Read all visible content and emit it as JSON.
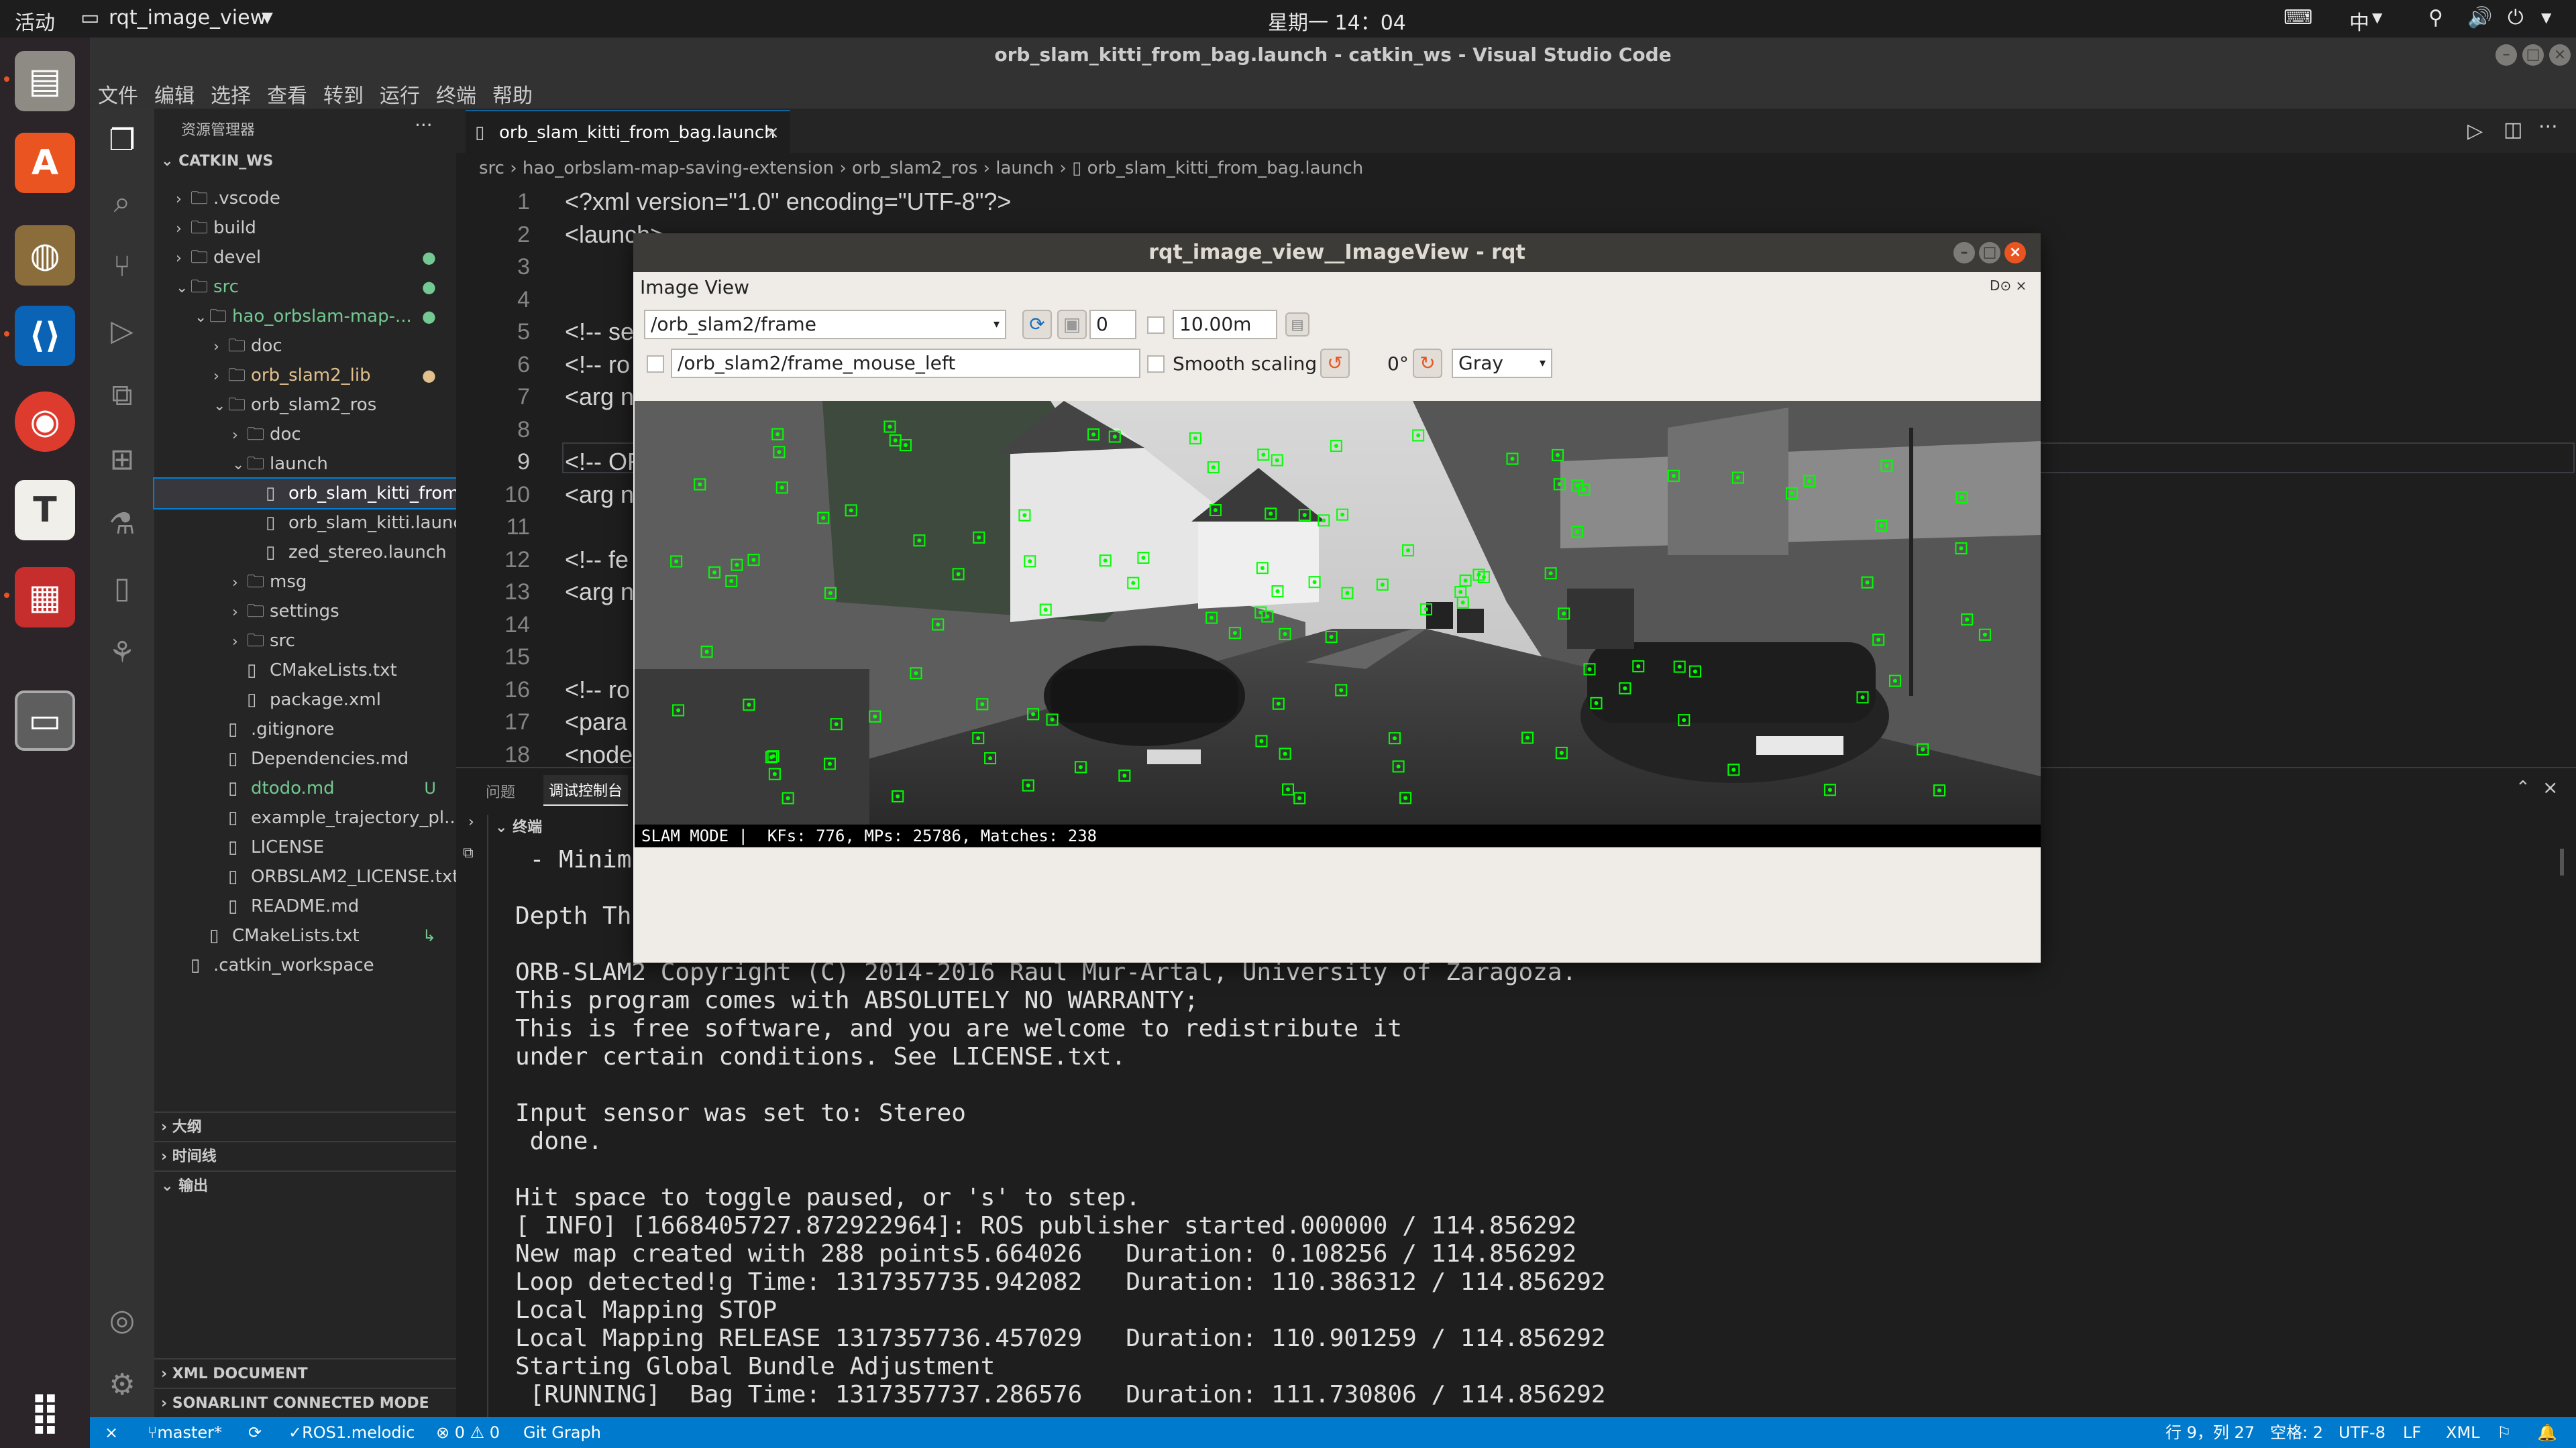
{
  "topbar": {
    "activities": "活动",
    "app_name": "rqt_image_view",
    "clock": "星期一 14：04",
    "ime": "中"
  },
  "window_title": "orb_slam_kitti_from_bag.launch - catkin_ws - Visual Studio Code",
  "menu": [
    "文件",
    "编辑",
    "选择",
    "查看",
    "转到",
    "运行",
    "终端",
    "帮助"
  ],
  "sidebar": {
    "title": "资源管理器",
    "root": "CATKIN_WS",
    "items": [
      {
        "label": ".vscode",
        "depth": 1,
        "kind": "folder",
        "open": false,
        "color": "#cccccc",
        "badge": ""
      },
      {
        "label": "build",
        "depth": 1,
        "kind": "folder",
        "open": false,
        "color": "#cccccc",
        "badge": ""
      },
      {
        "label": "devel",
        "depth": 1,
        "kind": "folder",
        "open": false,
        "color": "#cccccc",
        "badge": "●"
      },
      {
        "label": "src",
        "depth": 1,
        "kind": "folder",
        "open": true,
        "color": "#73c991",
        "badge": "●"
      },
      {
        "label": "hao_orbslam-map-...",
        "depth": 2,
        "kind": "folder",
        "open": true,
        "color": "#73c991",
        "badge": "●"
      },
      {
        "label": "doc",
        "depth": 3,
        "kind": "folder",
        "open": false,
        "color": "#cccccc",
        "badge": ""
      },
      {
        "label": "orb_slam2_lib",
        "depth": 3,
        "kind": "folder",
        "open": false,
        "color": "#e2c08d",
        "badge": "●"
      },
      {
        "label": "orb_slam2_ros",
        "depth": 3,
        "kind": "folder",
        "open": true,
        "color": "#cccccc",
        "badge": ""
      },
      {
        "label": "doc",
        "depth": 4,
        "kind": "folder",
        "open": false,
        "color": "#cccccc",
        "badge": ""
      },
      {
        "label": "launch",
        "depth": 4,
        "kind": "folder",
        "open": true,
        "color": "#cccccc",
        "badge": ""
      },
      {
        "label": "orb_slam_kitti_from...",
        "depth": 5,
        "kind": "file",
        "open": false,
        "color": "#ffffff",
        "badge": "",
        "selected": true
      },
      {
        "label": "orb_slam_kitti.launch",
        "depth": 5,
        "kind": "file",
        "open": false,
        "color": "#cccccc",
        "badge": ""
      },
      {
        "label": "zed_stereo.launch",
        "depth": 5,
        "kind": "file",
        "open": false,
        "color": "#cccccc",
        "badge": ""
      },
      {
        "label": "msg",
        "depth": 4,
        "kind": "folder",
        "open": false,
        "color": "#cccccc",
        "badge": ""
      },
      {
        "label": "settings",
        "depth": 4,
        "kind": "folder",
        "open": false,
        "color": "#cccccc",
        "badge": ""
      },
      {
        "label": "src",
        "depth": 4,
        "kind": "folder",
        "open": false,
        "color": "#cccccc",
        "badge": ""
      },
      {
        "label": "CMakeLists.txt",
        "depth": 4,
        "kind": "file",
        "open": false,
        "color": "#cccccc",
        "badge": ""
      },
      {
        "label": "package.xml",
        "depth": 4,
        "kind": "file",
        "open": false,
        "color": "#cccccc",
        "badge": ""
      },
      {
        "label": ".gitignore",
        "depth": 3,
        "kind": "file",
        "open": false,
        "color": "#cccccc",
        "badge": ""
      },
      {
        "label": "Dependencies.md",
        "depth": 3,
        "kind": "file",
        "open": false,
        "color": "#cccccc",
        "badge": ""
      },
      {
        "label": "dtodo.md",
        "depth": 3,
        "kind": "file",
        "open": false,
        "color": "#73c991",
        "badge": "U"
      },
      {
        "label": "example_trajectory_pl...",
        "depth": 3,
        "kind": "file",
        "open": false,
        "color": "#cccccc",
        "badge": ""
      },
      {
        "label": "LICENSE",
        "depth": 3,
        "kind": "file",
        "open": false,
        "color": "#cccccc",
        "badge": ""
      },
      {
        "label": "ORBSLAM2_LICENSE.txt",
        "depth": 3,
        "kind": "file",
        "open": false,
        "color": "#cccccc",
        "badge": ""
      },
      {
        "label": "README.md",
        "depth": 3,
        "kind": "file",
        "open": false,
        "color": "#cccccc",
        "badge": ""
      },
      {
        "label": "CMakeLists.txt",
        "depth": 2,
        "kind": "file",
        "open": false,
        "color": "#cccccc",
        "badge": "↳"
      },
      {
        "label": ".catkin_workspace",
        "depth": 1,
        "kind": "file",
        "open": false,
        "color": "#cccccc",
        "badge": ""
      }
    ],
    "sections": [
      "大纲",
      "时间线",
      "输出",
      "XML DOCUMENT",
      "SONARLINT CONNECTED MODE"
    ]
  },
  "editor": {
    "tab_label": "orb_slam_kitti_from_bag.launch",
    "breadcrumb": [
      "src",
      "hao_orbslam-map-saving-extension",
      "orb_slam2_ros",
      "launch",
      "orb_slam_kitti_from_bag.launch"
    ],
    "lines": [
      {
        "n": "1",
        "text": "<?xml version=\"1.0\" encoding=\"UTF-8\"?>"
      },
      {
        "n": "2",
        "text": "<launch>"
      },
      {
        "n": "3",
        "text": ""
      },
      {
        "n": "4",
        "text": ""
      },
      {
        "n": "5",
        "text": "<!-- se"
      },
      {
        "n": "6",
        "text": "<!-- ro"
      },
      {
        "n": "7",
        "text": "<arg n"
      },
      {
        "n": "8",
        "text": ""
      },
      {
        "n": "9",
        "text": "<!-- OR"
      },
      {
        "n": "10",
        "text": "<arg n"
      },
      {
        "n": "11",
        "text": ""
      },
      {
        "n": "12",
        "text": "<!-- fe"
      },
      {
        "n": "13",
        "text": "<arg n"
      },
      {
        "n": "14",
        "text": ""
      },
      {
        "n": "15",
        "text": ""
      },
      {
        "n": "16",
        "text": "<!-- ro"
      },
      {
        "n": "17",
        "text": "<para"
      },
      {
        "n": "18",
        "text": "<node"
      }
    ]
  },
  "panel": {
    "tabs": [
      "问题",
      "调试控制台"
    ],
    "terminal_label": "终端",
    "lines": [
      " - Minimum",
      "",
      "Depth Thr",
      "",
      "ORB-SLAM2 Copyright (C) 2014-2016 Raul Mur-Artal, University of Zaragoza.",
      "This program comes with ABSOLUTELY NO WARRANTY;",
      "This is free software, and you are welcome to redistribute it",
      "under certain conditions. See LICENSE.txt.",
      "",
      "Input sensor was set to: Stereo",
      " done.",
      "",
      "Hit space to toggle paused, or 's' to step.",
      "[ INFO] [1668405727.872922964]: ROS publisher started.000000 / 114.856292",
      "New map created with 288 points5.664026   Duration: 0.108256 / 114.856292",
      "Loop detected!g Time: 1317357735.942082   Duration: 110.386312 / 114.856292",
      "Local Mapping STOP",
      "Local Mapping RELEASE 1317357736.457029   Duration: 110.901259 / 114.856292",
      "Starting Global Bundle Adjustment",
      " [RUNNING]  Bag Time: 1317357737.286576   Duration: 111.730806 / 114.856292"
    ]
  },
  "statusbar": {
    "branch": "master*",
    "ros": "ROS1.melodic",
    "problems": "⊗ 0 ⚠ 0",
    "git_graph": "Git Graph",
    "position": "行 9，列 27",
    "spaces": "空格: 2",
    "encoding": "UTF-8",
    "eol": "LF",
    "language": "XML"
  },
  "rqt": {
    "title": "rqt_image_view__ImageView - rqt",
    "plugin_label": "Image View",
    "topic": "/orb_slam2/frame",
    "spin_value": "0",
    "max_range": "10.00m",
    "mouse_topic": "/orb_slam2/frame_mouse_left",
    "smooth_label": "Smooth scaling",
    "rotation": "0°",
    "color_scheme": "Gray",
    "slam_status": "SLAM MODE |  KFs: 776, MPs: 25786, Matches: 238"
  },
  "colors": {
    "accent": "#007acc",
    "feature_green": "#00ff00",
    "close_button": "#e95420"
  }
}
